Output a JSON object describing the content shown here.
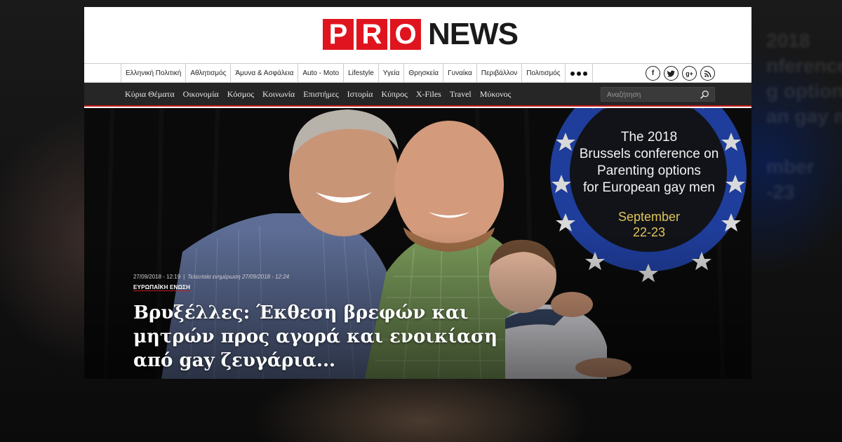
{
  "site": {
    "logo_letters": [
      "P",
      "R",
      "O"
    ],
    "logo_word": "NEWS",
    "brand_color": "#e0141e"
  },
  "topnav": {
    "items": [
      "Ελληνική Πολιτική",
      "Αθλητισμός",
      "Άμυνα & Ασφάλεια",
      "Auto - Moto",
      "Lifestyle",
      "Υγεία",
      "Θρησκεία",
      "Γυναίκα",
      "Περιβάλλον",
      "Πολιτισμός"
    ],
    "more_icon": "more-dots-icon",
    "social": [
      {
        "icon": "facebook-icon",
        "glyph": "f"
      },
      {
        "icon": "twitter-icon",
        "glyph": "t"
      },
      {
        "icon": "google-plus-icon",
        "glyph": "g+"
      },
      {
        "icon": "rss-icon",
        "glyph": "rss"
      }
    ]
  },
  "subnav": {
    "items": [
      "Κύρια Θέματα",
      "Οικονομία",
      "Κόσμος",
      "Κοινωνία",
      "Επιστήμες",
      "Ιστορία",
      "Κύπρος",
      "X-Files",
      "Travel",
      "Μύκονος"
    ],
    "search_placeholder": "Αναζήτηση",
    "accent_color": "#c31a1a"
  },
  "hero": {
    "badge": {
      "lines": [
        "The 2018",
        "Brussels conference on",
        "Parenting options",
        "for European gay men"
      ],
      "date_lines": [
        "September",
        "22-23"
      ]
    },
    "article": {
      "published": "27/09/2018 - 12:19",
      "updated": "Τελευταία ενημέρωση 27/09/2018 - 12:24",
      "category": "ΕΥΡΩΠΑΪΚΗ ΕΝΩΣΗ",
      "headline": "Βρυξέλλες: Έκθεση βρεφών και μητρών προς αγορά και ενοικίαση από gay ζευγάρια..."
    }
  },
  "backdrop": {
    "ghost_lines": [
      "2018",
      "nference o",
      "g options",
      "an gay m",
      "",
      "mber",
      "-23"
    ]
  }
}
